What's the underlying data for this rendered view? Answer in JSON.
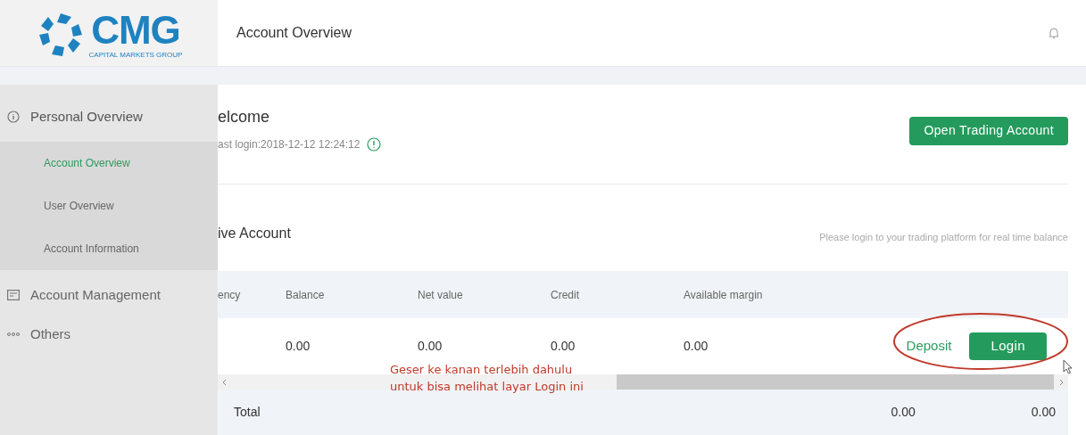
{
  "logo": {
    "name": "CMG",
    "tagline": "CAPITAL MARKETS GROUP"
  },
  "header": {
    "title": "Account Overview"
  },
  "sidebar": {
    "items": [
      {
        "label": "Personal Overview",
        "expanded": true,
        "children": [
          {
            "label": "Account Overview",
            "selected": true
          },
          {
            "label": "User Overview",
            "selected": false
          },
          {
            "label": "Account Information",
            "selected": false
          }
        ]
      },
      {
        "label": "Account Management",
        "expanded": false
      },
      {
        "label": "Others",
        "expanded": false
      }
    ]
  },
  "welcome": {
    "title": "elcome",
    "last_login": "ast login:2018-12-12 12:24:12",
    "button": "Open Trading Account"
  },
  "live_account": {
    "title": "ive Account",
    "hint": "Please login to your trading platform for real time balance",
    "columns": [
      "ency",
      "Balance",
      "Net value",
      "Credit",
      "Available margin"
    ],
    "rows": [
      {
        "values": [
          "0.00",
          "0.00",
          "0.00",
          "0.00"
        ],
        "actions": [
          {
            "kind": "link",
            "label": "Deposit"
          },
          {
            "kind": "button",
            "label": "Login"
          }
        ]
      }
    ],
    "total": {
      "label": "Total",
      "values": [
        "0.00",
        "0.00"
      ]
    }
  },
  "annotation": {
    "lines": [
      "Geser ke kanan terlebih dahulu",
      "untuk bisa melihat layar Login ini"
    ]
  }
}
